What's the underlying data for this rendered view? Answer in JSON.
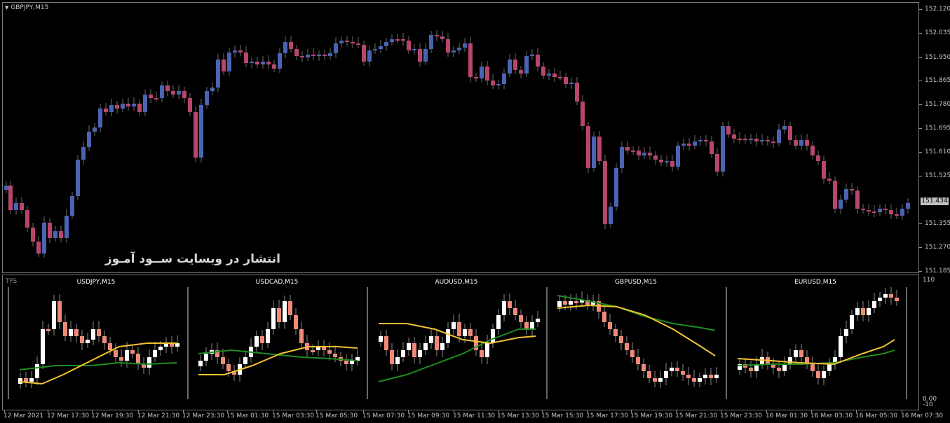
{
  "main_chart": {
    "title": "GBPJPY,M15",
    "price_labels": [
      "152.120",
      "152.035",
      "151.950",
      "151.865",
      "151.780",
      "151.695",
      "151.610",
      "151.525",
      "151.355",
      "151.270",
      "151.185"
    ],
    "current_price": "151.434",
    "bull_color": "#4a63b3",
    "bear_color": "#b8456d",
    "watermark": "انتشار در وبسایت ســود آمـوز"
  },
  "sub_chart": {
    "title": "TFS",
    "scale_labels": [
      "110",
      "0.00",
      "-10"
    ],
    "panels": [
      {
        "symbol": "USDJPY,M15"
      },
      {
        "symbol": "USDCAD,M15"
      },
      {
        "symbol": "AUDUSD,M15"
      },
      {
        "symbol": "GBPUSD,M15"
      },
      {
        "symbol": "EURUSD,M15"
      }
    ],
    "candle_up_color": "#ffffff",
    "candle_down_color": "#f08a78",
    "ma_fast_color": "#f2c232",
    "ma_slow_color": "#1e8c1e"
  },
  "time_axis": [
    "12 Mar 2021",
    "12 Mar 17:30",
    "12 Mar 19:30",
    "12 Mar 21:30",
    "12 Mar 23:30",
    "15 Mar 01:30",
    "15 Mar 03:30",
    "15 Mar 05:30",
    "15 Mar 07:30",
    "15 Mar 09:30",
    "15 Mar 11:30",
    "15 Mar 13:30",
    "15 Mar 15:30",
    "15 Mar 17:30",
    "15 Mar 19:30",
    "15 Mar 21:30",
    "15 Mar 23:30",
    "16 Mar 01:30",
    "16 Mar 03:30",
    "16 Mar 05:30",
    "16 Mar 07:30"
  ]
}
